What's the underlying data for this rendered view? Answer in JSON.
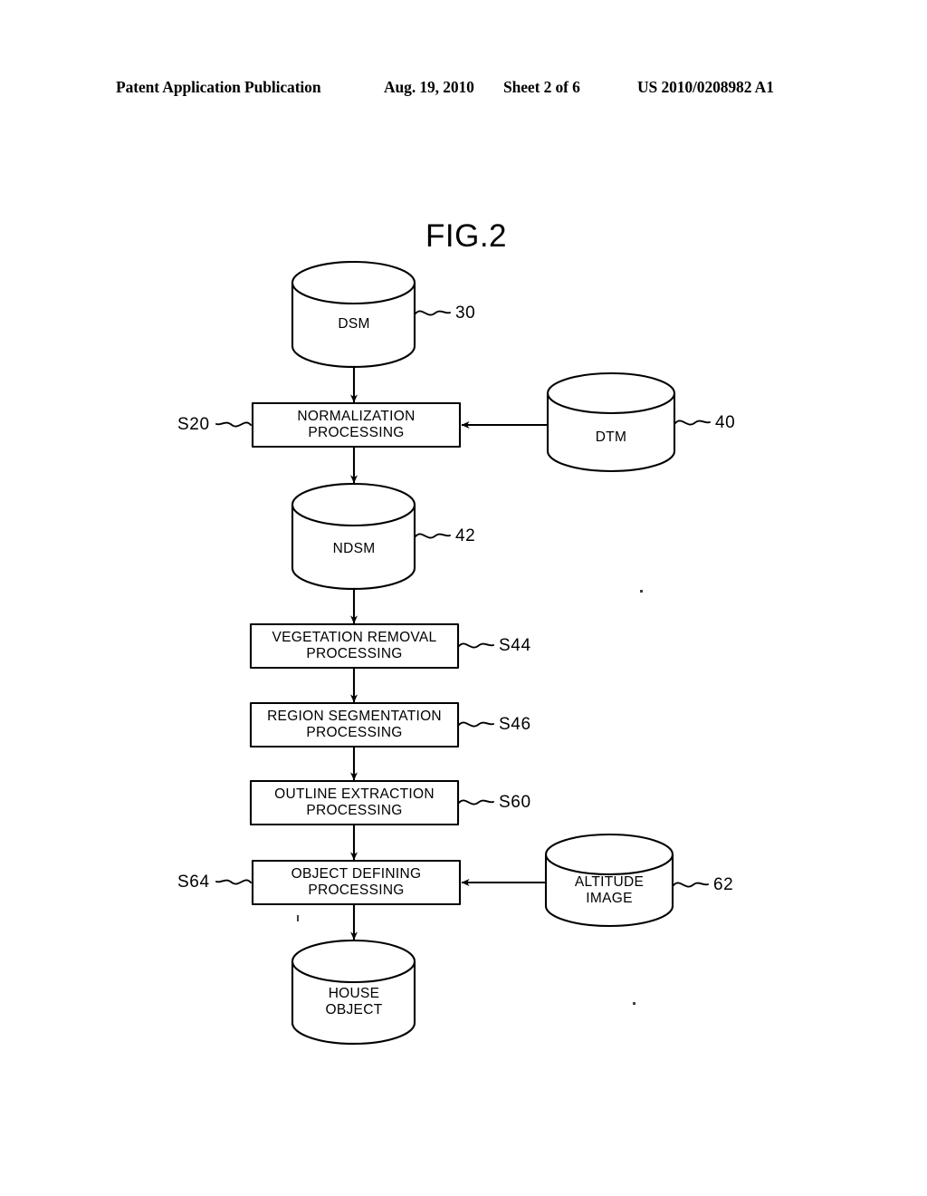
{
  "header": {
    "publication": "Patent Application Publication",
    "date": "Aug. 19, 2010",
    "sheet": "Sheet 2 of 6",
    "patent_number": "US 2010/0208982 A1"
  },
  "figure": {
    "title": "FIG.2",
    "nodes": [
      {
        "id": "dsm",
        "shape": "cylinder",
        "label": "DSM",
        "ref": "30"
      },
      {
        "id": "norm",
        "shape": "box",
        "label": "NORMALIZATION\nPROCESSING",
        "step": "S20"
      },
      {
        "id": "dtm",
        "shape": "cylinder",
        "label": "DTM",
        "ref": "40"
      },
      {
        "id": "ndsm",
        "shape": "cylinder",
        "label": "NDSM",
        "ref": "42"
      },
      {
        "id": "vegetation",
        "shape": "box",
        "label": "VEGETATION REMOVAL\nPROCESSING",
        "step": "S44"
      },
      {
        "id": "region",
        "shape": "box",
        "label": "REGION SEGMENTATION\nPROCESSING",
        "step": "S46"
      },
      {
        "id": "outline",
        "shape": "box",
        "label": "OUTLINE EXTRACTION\nPROCESSING",
        "step": "S60"
      },
      {
        "id": "object",
        "shape": "box",
        "label": "OBJECT DEFINING\nPROCESSING",
        "step": "S64"
      },
      {
        "id": "altitude",
        "shape": "cylinder",
        "label": "ALTITUDE\nIMAGE",
        "ref": "62"
      },
      {
        "id": "house",
        "shape": "cylinder",
        "label": "HOUSE\nOBJECT",
        "ref": ""
      }
    ],
    "labels": {
      "dsm": "DSM",
      "dsm_ref": "30",
      "normalization_line1": "NORMALIZATION",
      "normalization_line2": "PROCESSING",
      "normalization_step": "S20",
      "dtm": "DTM",
      "dtm_ref": "40",
      "ndsm": "NDSM",
      "ndsm_ref": "42",
      "vegetation_line1": "VEGETATION REMOVAL",
      "vegetation_line2": "PROCESSING",
      "vegetation_step": "S44",
      "region_line1": "REGION SEGMENTATION",
      "region_line2": "PROCESSING",
      "region_step": "S46",
      "outline_line1": "OUTLINE EXTRACTION",
      "outline_line2": "PROCESSING",
      "outline_step": "S60",
      "object_line1": "OBJECT DEFINING",
      "object_line2": "PROCESSING",
      "object_step": "S64",
      "altitude_line1": "ALTITUDE",
      "altitude_line2": "IMAGE",
      "altitude_ref": "62",
      "house_line1": "HOUSE",
      "house_line2": "OBJECT"
    },
    "flow": [
      {
        "from": "dsm",
        "to": "norm",
        "direction": "down"
      },
      {
        "from": "dtm",
        "to": "norm",
        "direction": "left"
      },
      {
        "from": "norm",
        "to": "ndsm",
        "direction": "down"
      },
      {
        "from": "ndsm",
        "to": "vegetation",
        "direction": "down"
      },
      {
        "from": "vegetation",
        "to": "region",
        "direction": "down"
      },
      {
        "from": "region",
        "to": "outline",
        "direction": "down"
      },
      {
        "from": "outline",
        "to": "object",
        "direction": "down"
      },
      {
        "from": "altitude",
        "to": "object",
        "direction": "left"
      },
      {
        "from": "object",
        "to": "house",
        "direction": "down"
      }
    ],
    "colors": {
      "stroke": "#000000",
      "background": "#ffffff"
    }
  }
}
